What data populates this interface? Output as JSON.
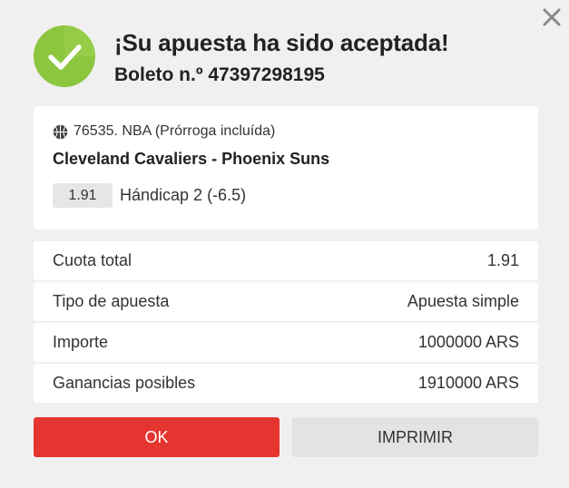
{
  "dialog": {
    "title": "¡Su apuesta ha sido aceptada!",
    "ticket": "Boleto n.º 47397298195",
    "close_icon": "close-icon",
    "success_icon": "check-circle-icon",
    "accent_color": "#8cc63f"
  },
  "event": {
    "icon": "basketball-icon",
    "meta": "76535. NBA (Prórroga incluída)",
    "match": "Cleveland Cavaliers - Phoenix Suns",
    "odds": "1.91",
    "selection": "Hándicap 2 (-6.5)"
  },
  "summary": [
    {
      "label": "Cuota total",
      "value": "1.91"
    },
    {
      "label": "Tipo de apuesta",
      "value": "Apuesta simple"
    },
    {
      "label": "Importe",
      "value": "1000000 ARS"
    },
    {
      "label": "Ganancias posibles",
      "value": "1910000 ARS"
    }
  ],
  "actions": {
    "ok_label": "OK",
    "print_label": "IMPRIMIR",
    "ok_color": "#e53530"
  }
}
